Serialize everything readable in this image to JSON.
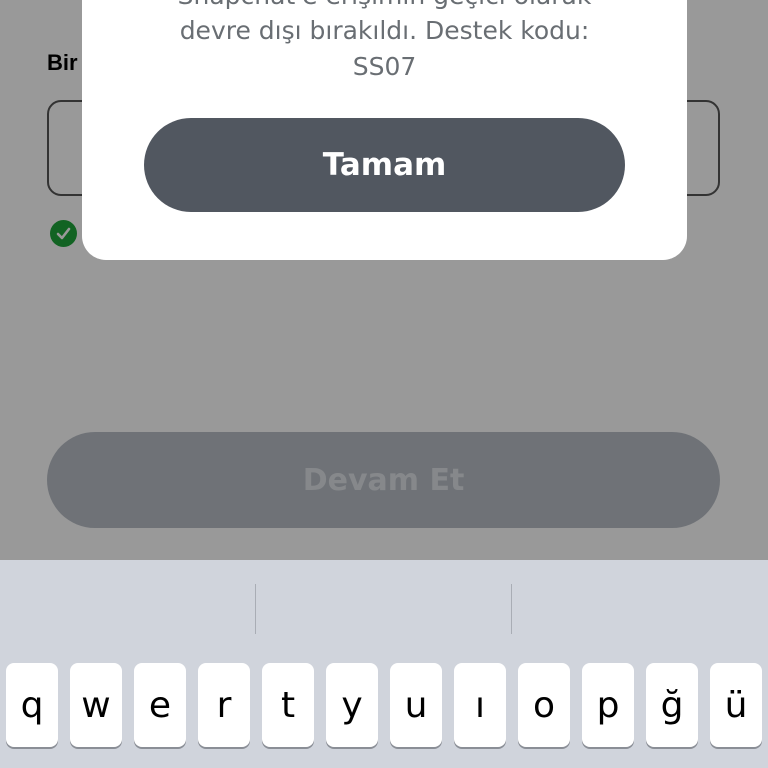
{
  "page": {
    "field_label": "Bir",
    "continue_label": "Devam Et"
  },
  "dialog": {
    "message_line1": "Snapchat'e erişimin geçici olarak",
    "message_line2": "devre dışı bırakıldı. Destek kodu:",
    "message_line3": "SS07",
    "ok_label": "Tamam"
  },
  "keyboard": {
    "keys": [
      "q",
      "w",
      "e",
      "r",
      "t",
      "y",
      "u",
      "ı",
      "o",
      "p",
      "ğ",
      "ü"
    ]
  },
  "colors": {
    "ok_button": "#515760",
    "check": "#1fa53b",
    "keyboard_bg": "#d0d4dc"
  }
}
